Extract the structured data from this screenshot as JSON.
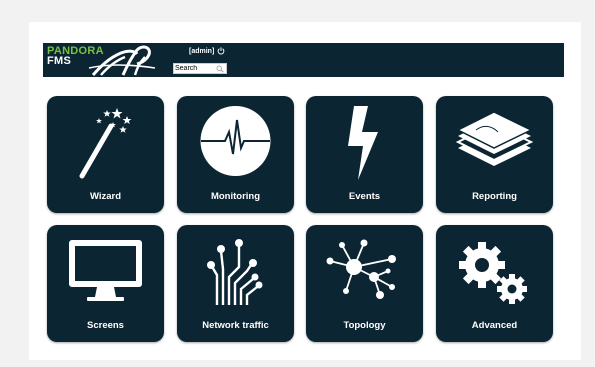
{
  "header": {
    "logo_line1": "PANDORA",
    "logo_line2": "FMS",
    "user": "[admin]",
    "search_placeholder": "Search"
  },
  "colors": {
    "tile_bg": "#0b2533",
    "logo_green": "#7ac142",
    "page_bg": "#f2f2f2"
  },
  "tiles": [
    {
      "label": "Wizard",
      "icon": "magic-wand-icon"
    },
    {
      "label": "Monitoring",
      "icon": "heartbeat-icon"
    },
    {
      "label": "Events",
      "icon": "lightning-icon"
    },
    {
      "label": "Reporting",
      "icon": "stacked-layers-icon"
    },
    {
      "label": "Screens",
      "icon": "monitor-icon"
    },
    {
      "label": "Network traffic",
      "icon": "circuit-icon"
    },
    {
      "label": "Topology",
      "icon": "network-nodes-icon"
    },
    {
      "label": "Advanced",
      "icon": "gears-icon"
    }
  ]
}
